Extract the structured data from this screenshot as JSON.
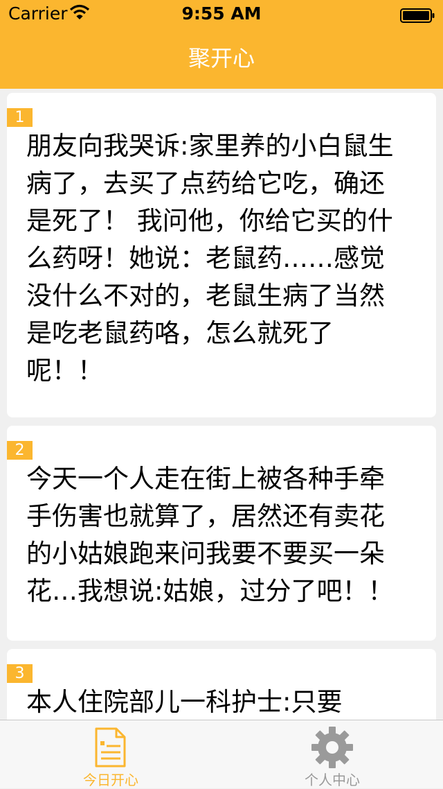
{
  "status_bar": {
    "carrier": "Carrier",
    "time": "9:55 AM"
  },
  "nav": {
    "title": "聚开心"
  },
  "feed": {
    "items": [
      {
        "index": "1",
        "text": "朋友向我哭诉:家里养的小白鼠生病了，去买了点药给它吃，确还是死了！ 我问他，你给它买的什么药呀！她说：老鼠药……感觉没什么不对的，老鼠生病了当然是吃老鼠药咯，怎么就死了呢！！"
      },
      {
        "index": "2",
        "text": "今天一个人走在街上被各种手牵手伤害也就算了，居然还有卖花的小姑娘跑来问我要不要买一朵花…我想说:姑娘，过分了吧！！"
      },
      {
        "index": "3",
        "text": "本人住院部儿一科护士:只要"
      }
    ]
  },
  "tabbar": {
    "tabs": [
      {
        "label": "今日开心",
        "icon": "document-icon",
        "active": true
      },
      {
        "label": "个人中心",
        "icon": "gear-icon",
        "active": false
      }
    ]
  },
  "colors": {
    "accent": "#fbb62f",
    "inactive": "#9a9a9a",
    "background": "#f0f0f0"
  }
}
